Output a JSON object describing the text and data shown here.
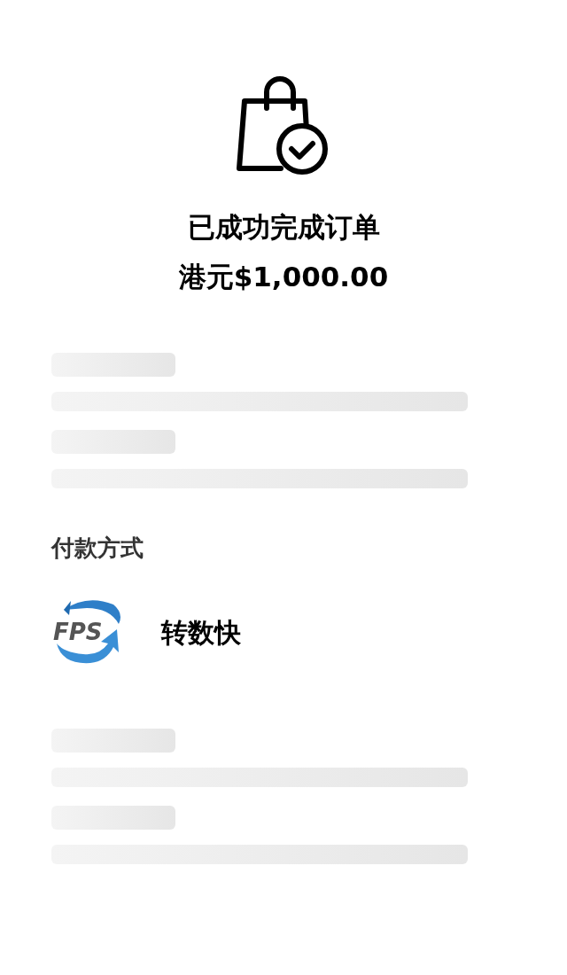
{
  "status": {
    "title": "已成功完成订单",
    "amount": "港元$1,000.00"
  },
  "placeholders_top": [
    {
      "kind": "label"
    },
    {
      "kind": "line"
    },
    {
      "kind": "label"
    },
    {
      "kind": "line"
    }
  ],
  "payment": {
    "heading": "付款方式",
    "logo_text": "FPS",
    "method": "转数快"
  },
  "placeholders_bottom": [
    {
      "kind": "label"
    },
    {
      "kind": "line"
    },
    {
      "kind": "label"
    },
    {
      "kind": "line"
    }
  ]
}
